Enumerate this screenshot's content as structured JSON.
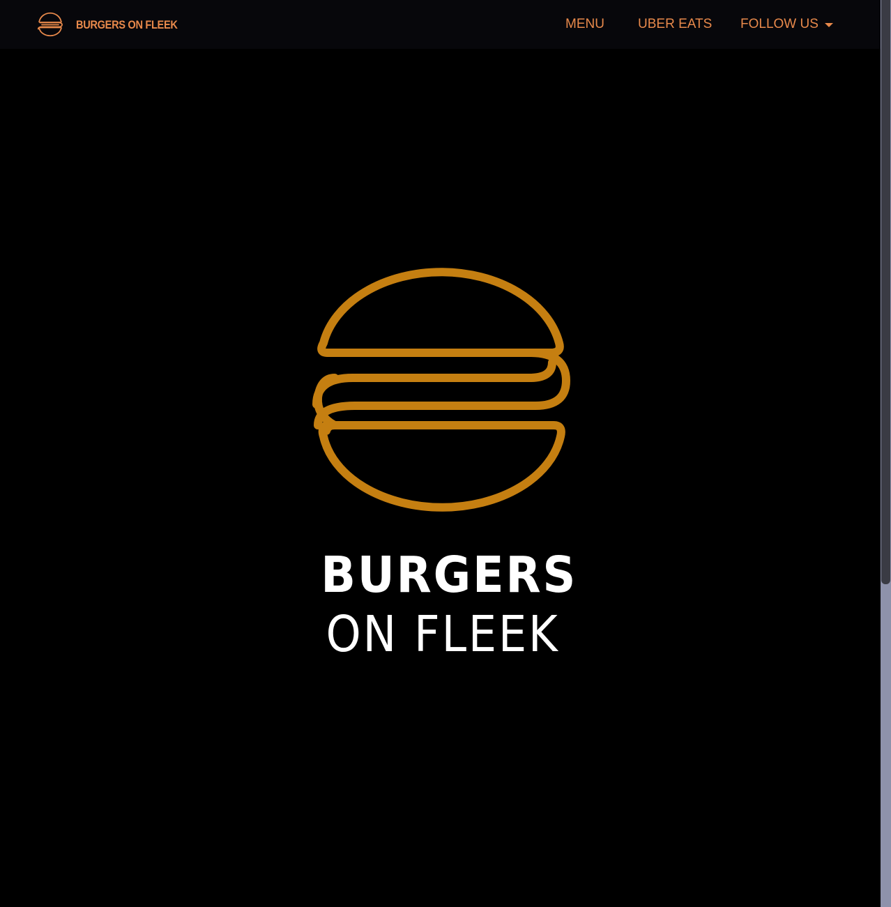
{
  "navbar": {
    "brand": {
      "name": "BURGERS ON FLEEK",
      "logo_icon": "burger-icon"
    },
    "links": {
      "menu": "MENU",
      "uber_eats": "UBER EATS",
      "follow_us": "FOLLOW US"
    },
    "follow_dropdown_icon": "caret-down-icon"
  },
  "hero": {
    "logo_icon": "burger-icon",
    "title_line1": "BURGERS",
    "title_line2": "ON FLEEK"
  },
  "colors": {
    "accent": "#e8894b",
    "logo_gold": "#c57f11",
    "background": "#000000",
    "navbar_background": "#07070b",
    "hero_text": "#ffffff",
    "scrollbar_track": "#8e92ab",
    "scrollbar_thumb": "#3a3b44"
  }
}
